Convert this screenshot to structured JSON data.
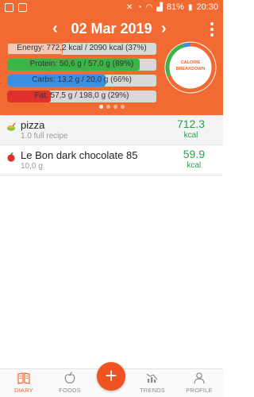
{
  "status_bar": {
    "battery": "81%",
    "time": "20:30"
  },
  "header": {
    "date": "02 Mar 2019",
    "prev_icon": "chevron-left-icon",
    "next_icon": "chevron-right-icon",
    "menu_icon": "more-vertical-icon",
    "accent_color": "#f06a31"
  },
  "nutrients": [
    {
      "key": "energy",
      "label": "Energy: 772,2 kcal  /  2090 kcal (37%)",
      "fraction": 0.37,
      "color": "#f6c9b6"
    },
    {
      "key": "protein",
      "label": "Protein: 50,6 g  /  57,0 g (89%)",
      "fraction": 0.89,
      "color": "#3db34a"
    },
    {
      "key": "carbs",
      "label": "Carbs: 13,2 g  /  20,0 g (66%)",
      "fraction": 0.66,
      "color": "#3b8fe0"
    },
    {
      "key": "fat",
      "label": "Fat: 57,5 g  /  198,0 g (29%)",
      "fraction": 0.29,
      "color": "#e0302c"
    }
  ],
  "donut": {
    "label_line1": "CALORIE",
    "label_line2": "BREAKDOWN",
    "segments": [
      {
        "name": "Fat",
        "share": 0.69,
        "color": "#f06a31"
      },
      {
        "name": "Protein",
        "share": 0.26,
        "color": "#3db34a"
      },
      {
        "name": "Carbs",
        "share": 0.05,
        "color": "#3b8fe0"
      }
    ]
  },
  "pager": {
    "count": 4,
    "active": 0
  },
  "items": [
    {
      "name": "pizza",
      "sub": "1.0 full recipe",
      "kcal": "712.3",
      "unit": "kcal",
      "icon": "recipe-bowl-icon"
    },
    {
      "name": "Le Bon dark chocolate 85",
      "sub": "10,0 g",
      "kcal": "59.9",
      "unit": "kcal",
      "icon": "apple-icon"
    }
  ],
  "nav": {
    "diary": "DIARY",
    "foods": "FOODS",
    "add": "+",
    "trends": "TRENDS",
    "profile": "PROFILE"
  }
}
